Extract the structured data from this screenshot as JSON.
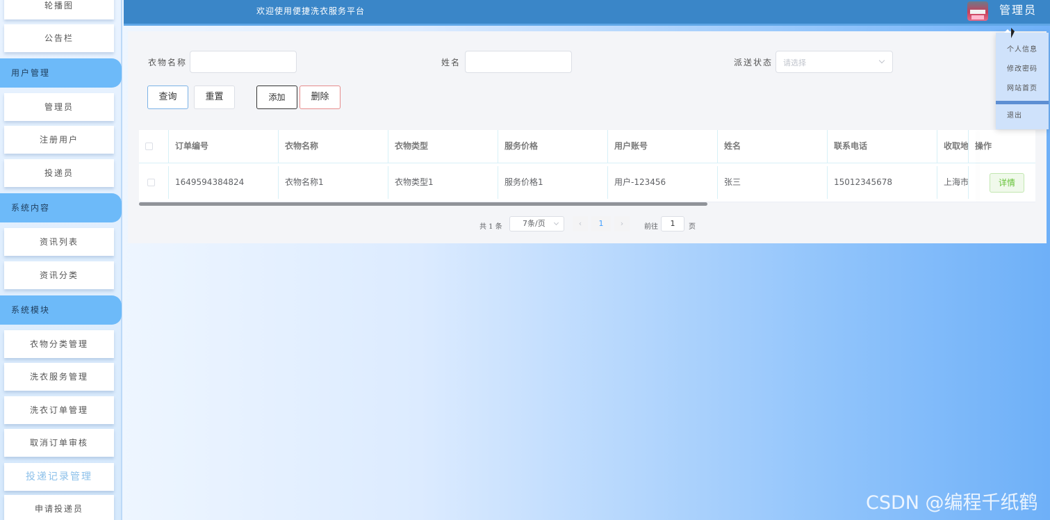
{
  "header": {
    "title": "欢迎使用便捷洗衣服务平台",
    "user": "管理员"
  },
  "user_menu": {
    "items": [
      "个人信息",
      "修改密码",
      "网站首页"
    ],
    "logout": "退出"
  },
  "sidebar": {
    "top_items": [
      "轮播图",
      "公告栏"
    ],
    "groups": [
      {
        "label": "用户管理",
        "items": [
          "管理员",
          "注册用户",
          "投递员"
        ]
      },
      {
        "label": "系统内容",
        "items": [
          "资讯列表",
          "资讯分类"
        ]
      },
      {
        "label": "系统模块",
        "items": [
          "衣物分类管理",
          "洗衣服务管理",
          "洗衣订单管理",
          "取消订单审核",
          "投递记录管理",
          "申请投递员"
        ]
      }
    ],
    "active_item": "投递记录管理"
  },
  "search": {
    "clothing_name_label": "衣物名称",
    "clothing_name_value": "",
    "name_label": "姓名",
    "name_value": "",
    "status_label": "派送状态",
    "status_placeholder": "请选择"
  },
  "buttons": {
    "query": "查询",
    "reset": "重置",
    "add": "添加",
    "delete": "删除"
  },
  "table": {
    "columns": [
      "订单编号",
      "衣物名称",
      "衣物类型",
      "服务价格",
      "用户账号",
      "姓名",
      "联系电话",
      "收取地址",
      "操作"
    ],
    "rows": [
      {
        "order_no": "1649594384824",
        "clothing_name": "衣物名称1",
        "clothing_type": "衣物类型1",
        "service_price": "服务价格1",
        "user_account": "用户-123456",
        "name": "张三",
        "phone": "15012345678",
        "address": "上海市",
        "action": "详情"
      }
    ]
  },
  "pagination": {
    "total": "共 1 条",
    "page_size": "7条/页",
    "prev": "‹",
    "current_page": "1",
    "next": "›",
    "goto_label": "前往",
    "goto_value": "1",
    "page_unit": "页"
  },
  "watermark": "CSDN @编程千纸鹤"
}
